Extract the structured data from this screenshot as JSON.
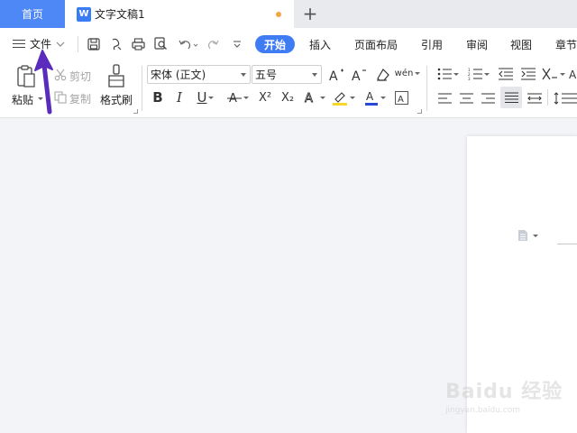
{
  "tabs": {
    "home_label": "首页",
    "doc_logo": "W",
    "doc_title": "文字文稿1",
    "new_tab_symbol": "+"
  },
  "menu": {
    "file_label": "文件",
    "items": [
      "开始",
      "插入",
      "页面布局",
      "引用",
      "审阅",
      "视图",
      "章节"
    ],
    "active_index": 0,
    "accent_color": "#3f7cf4"
  },
  "ribbon": {
    "paste_label": "粘贴",
    "cut_label": "剪切",
    "copy_label": "复制",
    "format_painter_label": "格式刷",
    "font_name": "宋体 (正文)",
    "font_size": "五号",
    "bold_symbol": "B",
    "italic_symbol": "I",
    "underline_symbol": "U",
    "superscript_symbol": "X²",
    "subscript_symbol": "X₂",
    "pinyin_symbol": "wén"
  },
  "icons": [
    "menu-icon",
    "chevron-down-icon",
    "save-icon",
    "undo-redo-icons",
    "print-icon",
    "preview-icon",
    "paste-icon",
    "scissors-icon",
    "copy-icon",
    "brush-icon",
    "align-icons"
  ],
  "colors": {
    "tab_home_bg": "#4e87f6",
    "highlight": "#f6d827",
    "font_color": "#2b47d8",
    "arrow": "#5b2bbd"
  },
  "watermark": {
    "brand": "Baidu 经验",
    "url": "jingyan.baidu.com"
  }
}
